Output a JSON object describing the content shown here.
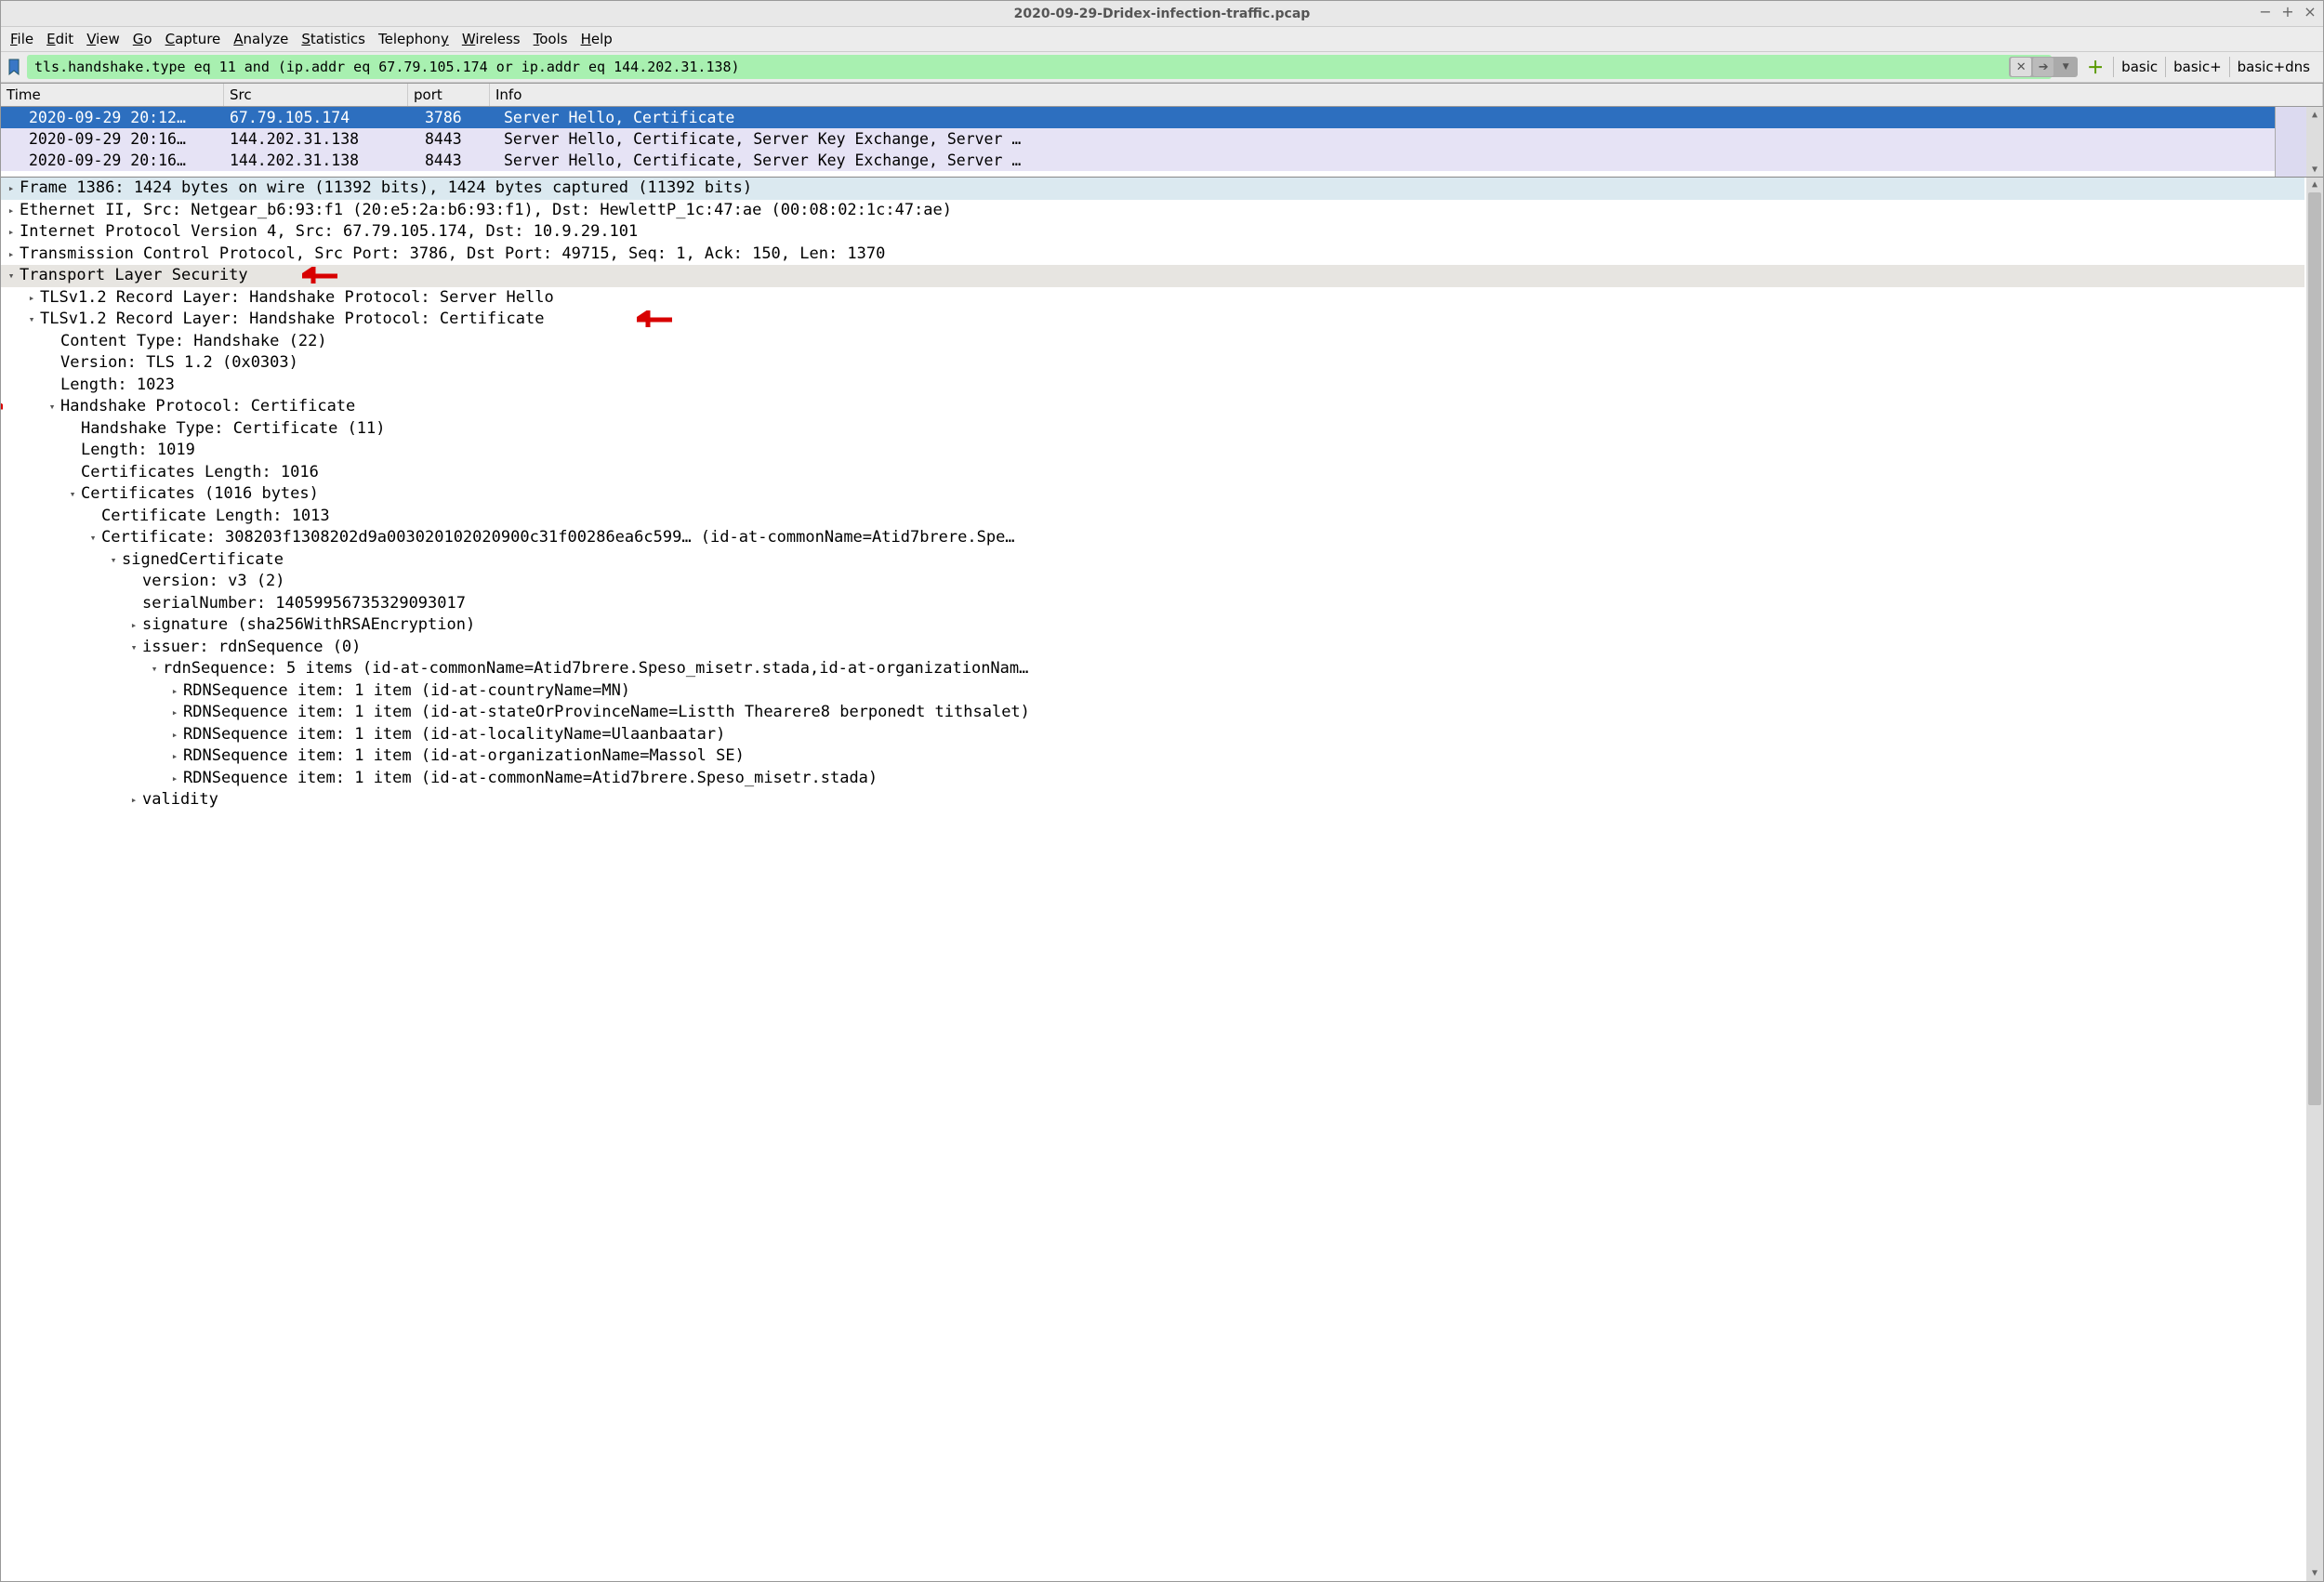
{
  "window": {
    "title": "2020-09-29-Dridex-infection-traffic.pcap"
  },
  "menu": {
    "file": "File",
    "edit": "Edit",
    "view": "View",
    "go": "Go",
    "capture": "Capture",
    "analyze": "Analyze",
    "statistics": "Statistics",
    "telephony": "Telephony",
    "wireless": "Wireless",
    "tools": "Tools",
    "help": "Help"
  },
  "filter": {
    "value": "tls.handshake.type eq 11 and (ip.addr eq 67.79.105.174 or ip.addr eq 144.202.31.138)"
  },
  "buttons": {
    "basic": "basic",
    "basic_plus": "basic+",
    "basic_dns": "basic+dns"
  },
  "columns": {
    "time": "Time",
    "src": "Src",
    "port": "port",
    "info": "Info"
  },
  "packets": [
    {
      "time": "2020-09-29 20:12…",
      "src": "67.79.105.174",
      "port": "3786",
      "info": "Server Hello, Certificate"
    },
    {
      "time": "2020-09-29 20:16…",
      "src": "144.202.31.138",
      "port": "8443",
      "info": "Server Hello, Certificate, Server Key Exchange, Server …"
    },
    {
      "time": "2020-09-29 20:16…",
      "src": "144.202.31.138",
      "port": "8443",
      "info": "Server Hello, Certificate, Server Key Exchange, Server …"
    }
  ],
  "tree": {
    "frame": "Frame 1386: 1424 bytes on wire (11392 bits), 1424 bytes captured (11392 bits)",
    "eth": "Ethernet II, Src: Netgear_b6:93:f1 (20:e5:2a:b6:93:f1), Dst: HewlettP_1c:47:ae (00:08:02:1c:47:ae)",
    "ip": "Internet Protocol Version 4, Src: 67.79.105.174, Dst: 10.9.29.101",
    "tcp": "Transmission Control Protocol, Src Port: 3786, Dst Port: 49715, Seq: 1, Ack: 150, Len: 1370",
    "tls": "Transport Layer Security",
    "rec1": "TLSv1.2 Record Layer: Handshake Protocol: Server Hello",
    "rec2": "TLSv1.2 Record Layer: Handshake Protocol: Certificate",
    "content_type": "Content Type: Handshake (22)",
    "version": "Version: TLS 1.2 (0x0303)",
    "length": "Length: 1023",
    "hs_proto": "Handshake Protocol: Certificate",
    "hs_type": "Handshake Type: Certificate (11)",
    "hs_len": "Length: 1019",
    "certs_len": "Certificates Length: 1016",
    "certs": "Certificates (1016 bytes)",
    "cert_len": "Certificate Length: 1013",
    "cert": "Certificate: 308203f1308202d9a003020102020900c31f00286ea6c599… (id-at-commonName=Atid7brere.Spe…",
    "signed": "signedCertificate",
    "sver": "version: v3 (2)",
    "serial": "serialNumber: 14059956735329093017",
    "sig": "signature (sha256WithRSAEncryption)",
    "issuer": "issuer: rdnSequence (0)",
    "rdn": "rdnSequence: 5 items (id-at-commonName=Atid7brere.Speso_misetr.stada,id-at-organizationNam…",
    "rdn1": "RDNSequence item: 1 item (id-at-countryName=MN)",
    "rdn2": "RDNSequence item: 1 item (id-at-stateOrProvinceName=Listth Thearere8 berponedt tithsalet)",
    "rdn3": "RDNSequence item: 1 item (id-at-localityName=Ulaanbaatar)",
    "rdn4": "RDNSequence item: 1 item (id-at-organizationName=Massol SE)",
    "rdn5": "RDNSequence item: 1 item (id-at-commonName=Atid7brere.Speso_misetr.stada)",
    "validity": "validity"
  }
}
